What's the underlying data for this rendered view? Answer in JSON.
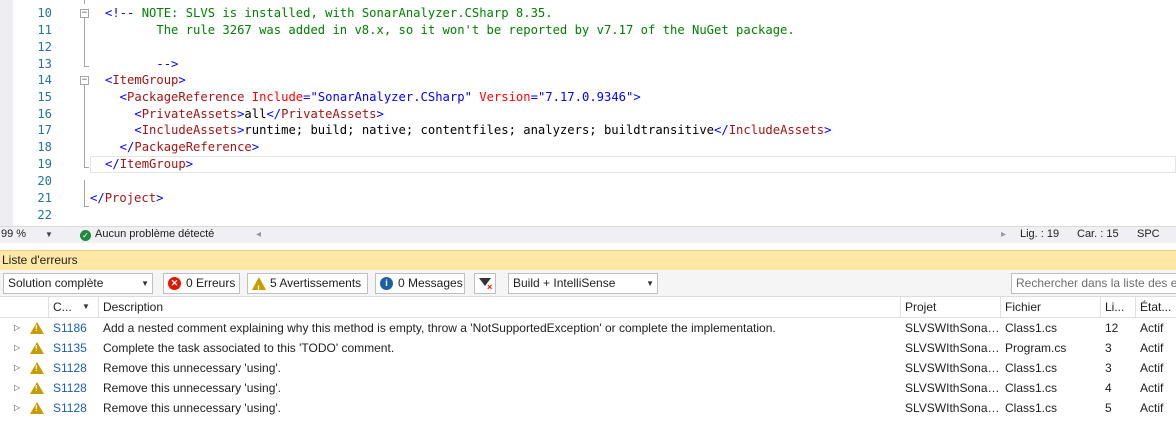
{
  "editor": {
    "lines": [
      {
        "num": "10",
        "segments": [
          {
            "c": "c-br",
            "t": "<!--"
          },
          {
            "c": "c-com",
            "t": " NOTE: SLVS is installed, with SonarAnalyzer.CSharp 8.35."
          }
        ]
      },
      {
        "num": "11",
        "segments": [
          {
            "c": "c-com",
            "t": "       The rule 3267 was added in v8.x, so it won't be reported by v7.17 of the NuGet package."
          }
        ]
      },
      {
        "num": "12",
        "segments": []
      },
      {
        "num": "13",
        "segments": [
          {
            "c": "c-br",
            "t": "       -->"
          }
        ]
      },
      {
        "num": "14",
        "segments": [
          {
            "c": "c-br",
            "t": "<"
          },
          {
            "c": "c-tag",
            "t": "ItemGroup"
          },
          {
            "c": "c-br",
            "t": ">"
          }
        ]
      },
      {
        "num": "15",
        "segments": [
          {
            "c": "c-br",
            "t": "  <"
          },
          {
            "c": "c-tag",
            "t": "PackageReference"
          },
          {
            "c": "c-attr",
            "t": " Include"
          },
          {
            "c": "c-br",
            "t": "=\""
          },
          {
            "c": "c-val",
            "t": "SonarAnalyzer.CSharp"
          },
          {
            "c": "c-br",
            "t": "\""
          },
          {
            "c": "c-attr",
            "t": " Version"
          },
          {
            "c": "c-br",
            "t": "=\""
          },
          {
            "c": "c-val",
            "t": "7.17.0.9346"
          },
          {
            "c": "c-br",
            "t": "\">"
          }
        ]
      },
      {
        "num": "16",
        "segments": [
          {
            "c": "c-br",
            "t": "    <"
          },
          {
            "c": "c-tag",
            "t": "PrivateAssets"
          },
          {
            "c": "c-br",
            "t": ">"
          },
          {
            "c": "c-txt",
            "t": "all"
          },
          {
            "c": "c-br",
            "t": "</"
          },
          {
            "c": "c-tag",
            "t": "PrivateAssets"
          },
          {
            "c": "c-br",
            "t": ">"
          }
        ]
      },
      {
        "num": "17",
        "segments": [
          {
            "c": "c-br",
            "t": "    <"
          },
          {
            "c": "c-tag",
            "t": "IncludeAssets"
          },
          {
            "c": "c-br",
            "t": ">"
          },
          {
            "c": "c-txt",
            "t": "runtime; build; native; contentfiles; analyzers; buildtransitive"
          },
          {
            "c": "c-br",
            "t": "</"
          },
          {
            "c": "c-tag",
            "t": "IncludeAssets"
          },
          {
            "c": "c-br",
            "t": ">"
          }
        ]
      },
      {
        "num": "18",
        "segments": [
          {
            "c": "c-br",
            "t": "  </"
          },
          {
            "c": "c-tag",
            "t": "PackageReference"
          },
          {
            "c": "c-br",
            "t": ">"
          }
        ]
      },
      {
        "num": "19",
        "segments": [
          {
            "c": "c-br",
            "t": "</"
          },
          {
            "c": "c-tag",
            "t": "ItemGroup"
          },
          {
            "c": "c-br",
            "t": ">"
          }
        ]
      },
      {
        "num": "20",
        "segments": []
      },
      {
        "num": "21",
        "segments": [
          {
            "c": "c-br",
            "t": "</"
          },
          {
            "c": "c-tag",
            "t": "Project"
          },
          {
            "c": "c-br",
            "t": ">"
          }
        ]
      },
      {
        "num": "22",
        "segments": []
      }
    ]
  },
  "status": {
    "zoom": "99 %",
    "issues": "Aucun problème détecté",
    "ln": "Lig. : 19",
    "col": "Car. : 15",
    "mode": "SPC"
  },
  "error_list": {
    "title": "Liste d'erreurs",
    "scope": "Solution complète",
    "errors": "0 Erreurs",
    "warnings": "5 Avertissements",
    "messages": "0 Messages",
    "build_mode": "Build + IntelliSense",
    "search_placeholder": "Rechercher dans la liste des erreurs",
    "columns": {
      "code": "C...",
      "description": "Description",
      "project": "Projet",
      "file": "Fichier",
      "line": "Li...",
      "state": "État..."
    },
    "rows": [
      {
        "code": "S1186",
        "description": "Add a nested comment explaining why this method is empty, throw a 'NotSupportedException' or complete the implementation.",
        "project": "SLVSWIthSonarN...",
        "file": "Class1.cs",
        "line": "12",
        "state": "Actif"
      },
      {
        "code": "S1135",
        "description": "Complete the task associated to this 'TODO' comment.",
        "project": "SLVSWIthSonarN...",
        "file": "Program.cs",
        "line": "3",
        "state": "Actif"
      },
      {
        "code": "S1128",
        "description": "Remove this unnecessary 'using'.",
        "project": "SLVSWIthSonarN...",
        "file": "Class1.cs",
        "line": "3",
        "state": "Actif"
      },
      {
        "code": "S1128",
        "description": "Remove this unnecessary 'using'.",
        "project": "SLVSWIthSonarN...",
        "file": "Class1.cs",
        "line": "4",
        "state": "Actif"
      },
      {
        "code": "S1128",
        "description": "Remove this unnecessary 'using'.",
        "project": "SLVSWIthSonarN...",
        "file": "Class1.cs",
        "line": "5",
        "state": "Actif"
      }
    ]
  }
}
